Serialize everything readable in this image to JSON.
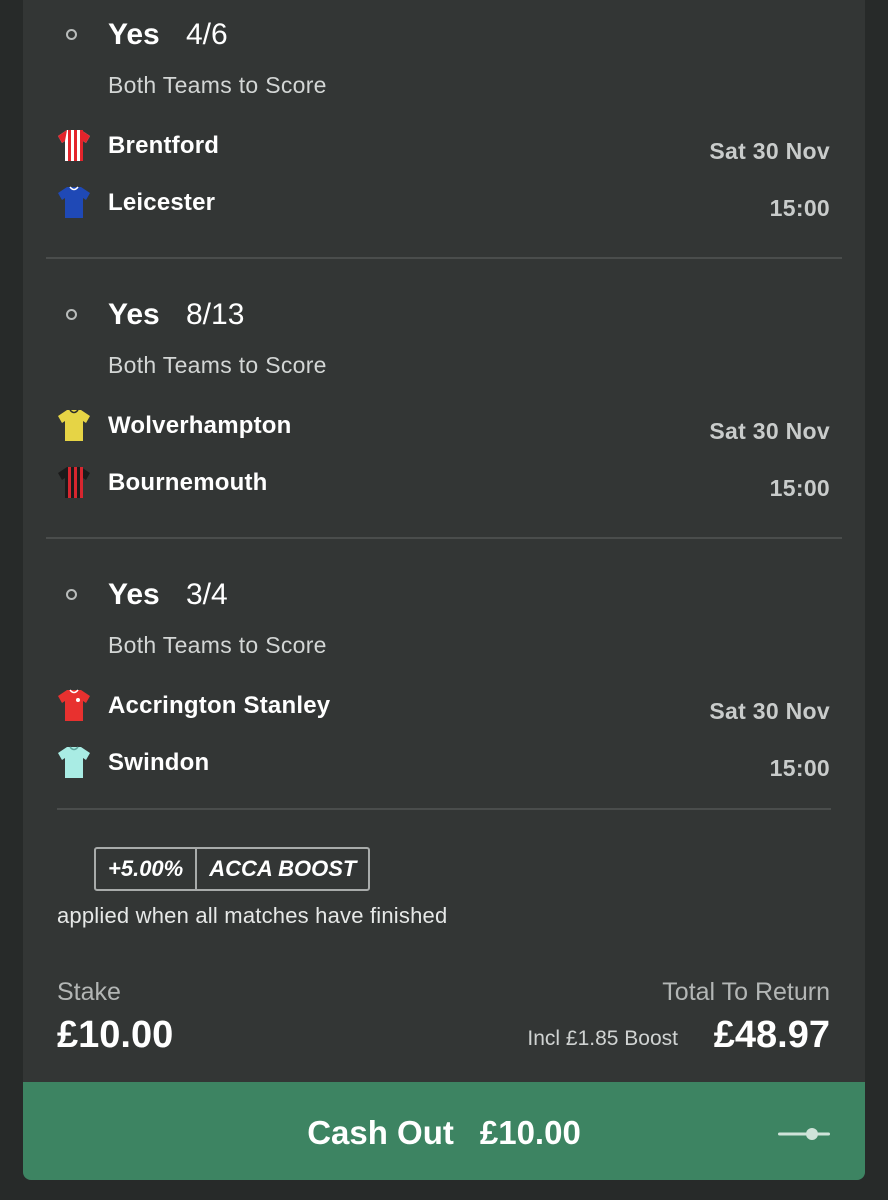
{
  "selections": [
    {
      "pick": "Yes",
      "odds": "4/6",
      "market": "Both Teams to Score",
      "home": {
        "name": "Brentford",
        "kit_icon": "striped-kit-icon",
        "kit_colors": [
          "#e3242b",
          "#ffffff"
        ]
      },
      "away": {
        "name": "Leicester",
        "kit_icon": "solid-kit-icon",
        "kit_colors": [
          "#1f49b6",
          "#1f49b6"
        ]
      },
      "date": "Sat 30 Nov",
      "time": "15:00"
    },
    {
      "pick": "Yes",
      "odds": "8/13",
      "market": "Both Teams to Score",
      "home": {
        "name": "Wolverhampton",
        "kit_icon": "solid-kit-icon",
        "kit_colors": [
          "#e6d445",
          "#e6d445"
        ]
      },
      "away": {
        "name": "Bournemouth",
        "kit_icon": "striped-kit-icon",
        "kit_colors": [
          "#d7262f",
          "#1b1b1b"
        ]
      },
      "date": "Sat 30 Nov",
      "time": "15:00"
    },
    {
      "pick": "Yes",
      "odds": "3/4",
      "market": "Both Teams to Score",
      "home": {
        "name": "Accrington Stanley",
        "kit_icon": "solid-kit-icon",
        "kit_colors": [
          "#e8312f",
          "#e8312f"
        ]
      },
      "away": {
        "name": "Swindon",
        "kit_icon": "solid-kit-icon",
        "kit_colors": [
          "#a9ece4",
          "#a9ece4"
        ]
      },
      "date": "Sat 30 Nov",
      "time": "15:00"
    }
  ],
  "boost": {
    "percent": "+5.00%",
    "name": "ACCA BOOST",
    "note": "applied when all matches have finished"
  },
  "stake": {
    "label": "Stake",
    "value": "£10.00"
  },
  "returns": {
    "label": "Total To Return",
    "boost_incl": "Incl £1.85 Boost",
    "value": "£48.97"
  },
  "cashout": {
    "label": "Cash Out",
    "amount": "£10.00"
  },
  "colors": {
    "accent": "#3d8462",
    "background": "#272a29",
    "card": "#333635"
  }
}
